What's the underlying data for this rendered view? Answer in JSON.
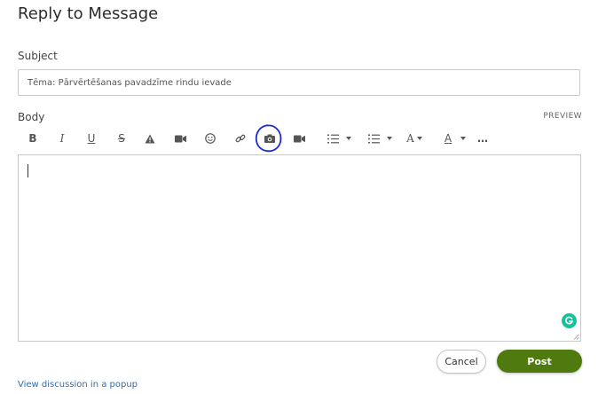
{
  "page": {
    "title": "Reply to Message"
  },
  "subject": {
    "label": "Subject",
    "value": "Tēma: Pārvērtēšanas pavadzīme rindu ievade"
  },
  "body": {
    "label": "Body",
    "preview_label": "PREVIEW",
    "value": ""
  },
  "toolbar": {
    "bold_glyph": "B",
    "italic_glyph": "I",
    "underline_glyph": "U",
    "strike_glyph": "S",
    "font_glyph": "A",
    "color_glyph": "A",
    "more_glyph": "…"
  },
  "actions": {
    "cancel_label": "Cancel",
    "post_label": "Post"
  },
  "footer": {
    "popup_link": "View discussion in a popup"
  },
  "colors": {
    "accent_green": "#4f7a0f",
    "link_blue": "#2f6fb0",
    "grammarly_green": "#15c39a",
    "annotation_blue": "#1a2bd6"
  }
}
